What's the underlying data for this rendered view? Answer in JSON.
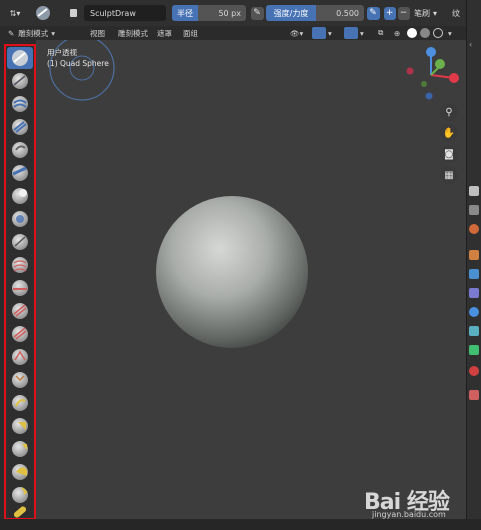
{
  "header": {
    "mode_icon": "sculpt-mode-icon",
    "brush_name": "SculptDraw",
    "radius_label": "半径",
    "radius_value": "50 px",
    "strength_label": "强度/力度",
    "strength_value": "0.500",
    "plus_label": "+",
    "minus_label": "−",
    "stroke_label": "笔刷",
    "texture_label": "纹"
  },
  "menu": {
    "mode": "雕刻模式",
    "view": "视图",
    "sculpt": "雕刻模式",
    "mask": "遮罩",
    "face_sets": "面组"
  },
  "viewport": {
    "view_name": "用户透视",
    "object_name": "(1) Quad Sphere",
    "gizmo_x": "X",
    "gizmo_y": "Y",
    "gizmo_z": "Z"
  },
  "toolbar": {
    "tools": [
      {
        "name": "draw",
        "icon": "draw-brush-icon"
      },
      {
        "name": "draw-sharp",
        "icon": "draw-sharp-brush-icon"
      },
      {
        "name": "clay",
        "icon": "clay-brush-icon"
      },
      {
        "name": "clay-strips",
        "icon": "clay-strips-brush-icon"
      },
      {
        "name": "clay-thumb",
        "icon": "clay-thumb-brush-icon"
      },
      {
        "name": "layer",
        "icon": "layer-brush-icon"
      },
      {
        "name": "inflate",
        "icon": "inflate-brush-icon"
      },
      {
        "name": "blob",
        "icon": "blob-brush-icon"
      },
      {
        "name": "crease",
        "icon": "crease-brush-icon"
      },
      {
        "name": "smooth",
        "icon": "smooth-brush-icon"
      },
      {
        "name": "flatten",
        "icon": "flatten-brush-icon"
      },
      {
        "name": "fill",
        "icon": "fill-brush-icon"
      },
      {
        "name": "scrape",
        "icon": "scrape-brush-icon"
      },
      {
        "name": "multiplane-scrape",
        "icon": "multiplane-scrape-brush-icon"
      },
      {
        "name": "pinch",
        "icon": "pinch-brush-icon"
      },
      {
        "name": "grab",
        "icon": "grab-brush-icon"
      },
      {
        "name": "elastic-deform",
        "icon": "elastic-deform-brush-icon"
      },
      {
        "name": "snake-hook",
        "icon": "snake-hook-brush-icon"
      },
      {
        "name": "thumb",
        "icon": "thumb-brush-icon"
      },
      {
        "name": "pose",
        "icon": "pose-brush-icon"
      },
      {
        "name": "mask",
        "icon": "mask-brush-icon"
      }
    ]
  },
  "watermark": {
    "brand": "Bai  经验",
    "url": "jingyan.baidu.com"
  },
  "colors": {
    "accent": "#4772b3",
    "highlight_border": "#e0101a",
    "viewport_bg": "#3d3d3d"
  }
}
